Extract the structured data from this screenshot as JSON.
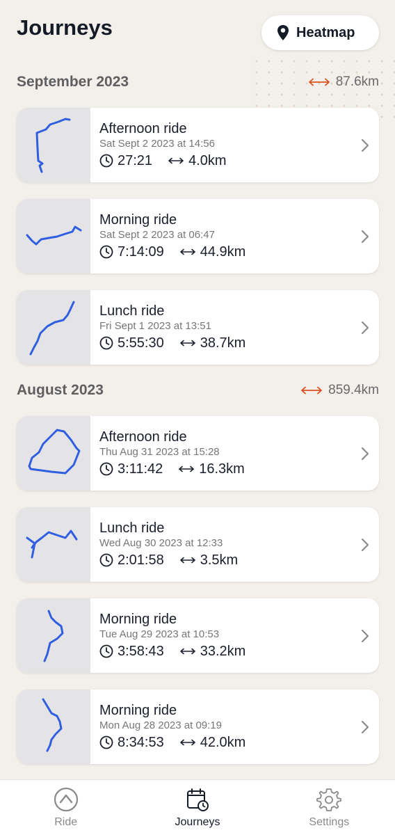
{
  "header": {
    "title": "Journeys",
    "heatmap_label": "Heatmap"
  },
  "sections": [
    {
      "title": "September 2023",
      "total": "87.6km",
      "journeys": [
        {
          "name": "Afternoon ride",
          "date": "Sat Sept 2 2023 at 14:56",
          "duration": "27:21",
          "distance": "4.0km"
        },
        {
          "name": "Morning ride",
          "date": "Sat Sept 2 2023 at 06:47",
          "duration": "7:14:09",
          "distance": "44.9km"
        },
        {
          "name": "Lunch ride",
          "date": "Fri Sept 1 2023 at 13:51",
          "duration": "5:55:30",
          "distance": "38.7km"
        }
      ]
    },
    {
      "title": "August 2023",
      "total": "859.4km",
      "journeys": [
        {
          "name": "Afternoon ride",
          "date": "Thu Aug 31 2023 at 15:28",
          "duration": "3:11:42",
          "distance": "16.3km"
        },
        {
          "name": "Lunch ride",
          "date": "Wed Aug 30 2023 at 12:33",
          "duration": "2:01:58",
          "distance": "3.5km"
        },
        {
          "name": "Morning ride",
          "date": "Tue Aug 29 2023 at 10:53",
          "duration": "3:58:43",
          "distance": "33.2km"
        },
        {
          "name": "Morning ride",
          "date": "Mon Aug 28 2023 at 09:19",
          "duration": "8:34:53",
          "distance": "42.0km"
        }
      ]
    }
  ],
  "tabs": [
    {
      "label": "Ride",
      "icon": "ride-icon",
      "active": false
    },
    {
      "label": "Journeys",
      "icon": "calendar-clock-icon",
      "active": true
    },
    {
      "label": "Settings",
      "icon": "gear-icon",
      "active": false
    }
  ],
  "colors": {
    "route": "#2f5fe0",
    "accent": "#d9531e",
    "background": "#f3f0eb"
  }
}
